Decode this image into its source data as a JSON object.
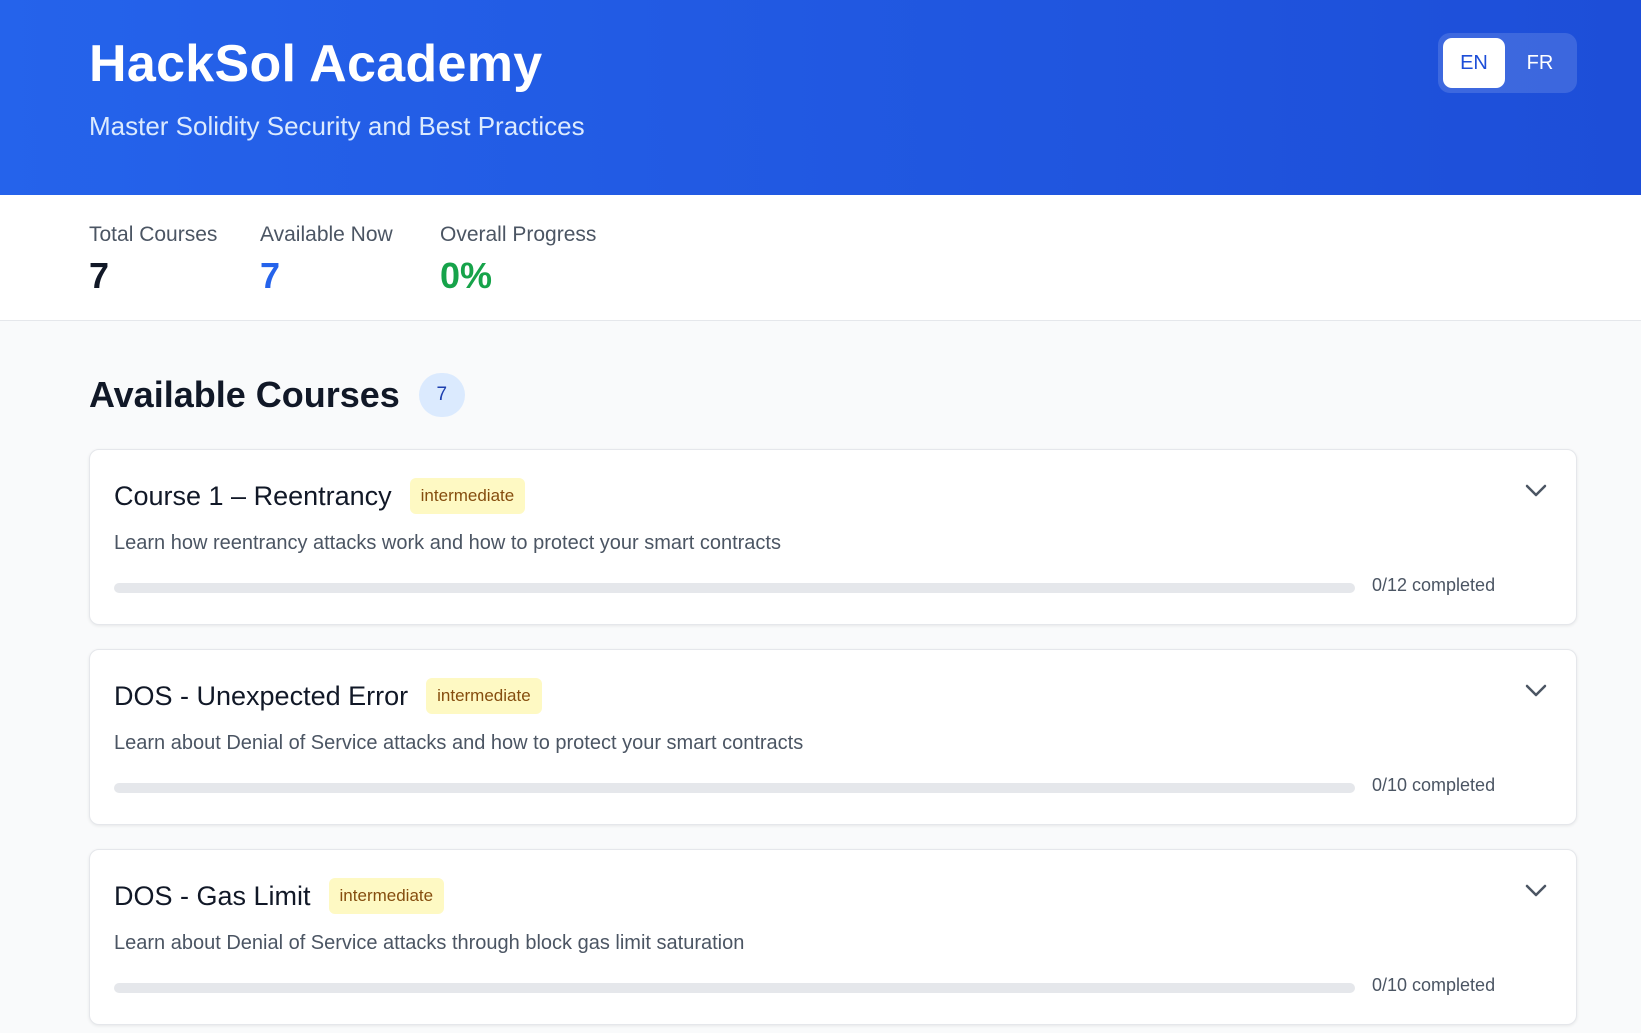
{
  "header": {
    "title": "HackSol Academy",
    "subtitle": "Master Solidity Security and Best Practices",
    "languages": [
      {
        "label": "EN",
        "active": true
      },
      {
        "label": "FR",
        "active": false
      }
    ]
  },
  "stats": {
    "total_label": "Total Courses",
    "total_value": "7",
    "available_label": "Available Now",
    "available_value": "7",
    "progress_label": "Overall Progress",
    "progress_value": "0%"
  },
  "section": {
    "title": "Available Courses",
    "count": "7"
  },
  "courses": [
    {
      "title": "Course 1 – Reentrancy",
      "level": "intermediate",
      "description": "Learn how reentrancy attacks work and how to protect your smart contracts",
      "completed": 0,
      "total": 12,
      "progress_text": "0/12 completed"
    },
    {
      "title": "DOS - Unexpected Error",
      "level": "intermediate",
      "description": "Learn about Denial of Service attacks and how to protect your smart contracts",
      "completed": 0,
      "total": 10,
      "progress_text": "0/10 completed"
    },
    {
      "title": "DOS - Gas Limit",
      "level": "intermediate",
      "description": "Learn about Denial of Service attacks through block gas limit saturation",
      "completed": 0,
      "total": 10,
      "progress_text": "0/10 completed"
    }
  ],
  "icons": {
    "expand": "chevron-down-icon"
  },
  "colors": {
    "header_start": "#2563eb",
    "header_end": "#1d4ed8",
    "accent": "#2563eb",
    "success": "#16a34a",
    "level_badge_bg": "#fef9c3",
    "level_badge_text": "#854d0e"
  }
}
